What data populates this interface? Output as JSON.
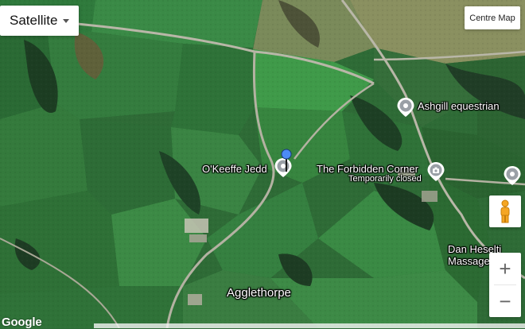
{
  "map_type": {
    "label": "Satellite"
  },
  "centre_button": {
    "label": "Centre Map"
  },
  "places": [
    {
      "key": "ashgill",
      "label": "Ashgill equestrian",
      "icon": "place-pin-icon"
    },
    {
      "key": "okeeffe",
      "label": "O'Keeffe Jedd",
      "icon": "place-pin-icon"
    },
    {
      "key": "forbidden",
      "label": "The Forbidden Corner",
      "sublabel": "Temporarily closed",
      "icon": "camera-pin-icon"
    },
    {
      "key": "dan",
      "label": "Dan Heselti",
      "sublabel": "Massage Ther",
      "icon": "place-pin-icon"
    }
  ],
  "town": {
    "label": "Agglethorpe"
  },
  "watermark": "Google",
  "controls": {
    "zoom_in": "+",
    "zoom_out": "−"
  },
  "colors": {
    "marker": "#4c8bf5",
    "pin": "#9aa0a6",
    "control_bg": "#ffffff"
  }
}
